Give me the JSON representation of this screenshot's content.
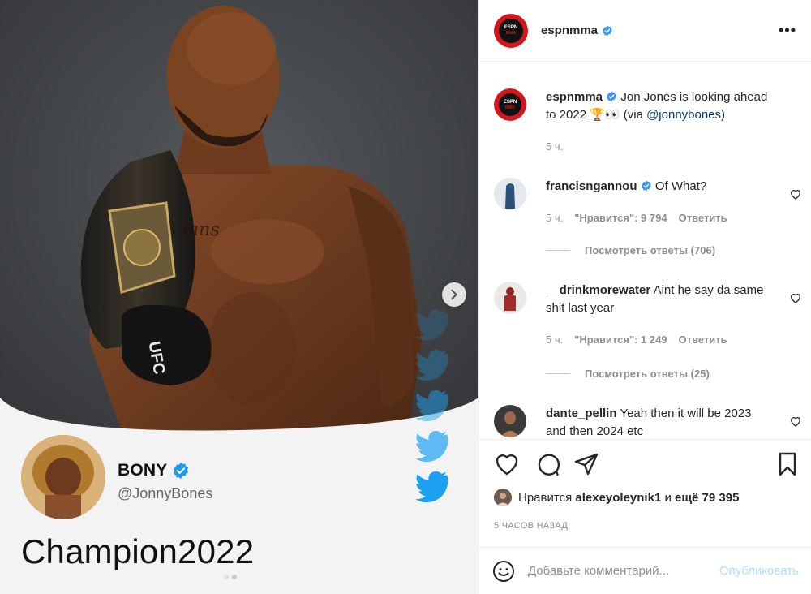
{
  "post": {
    "author": "espnmma",
    "logo_text_top": "ESPN",
    "logo_text_bottom": "MMA",
    "caption_text": "Jon Jones is looking ahead to 2022 🏆👀 (via",
    "caption_mention": "@jonnybones",
    "caption_close": ")",
    "caption_time": "5 ч."
  },
  "media": {
    "tweet_name": "BONY",
    "tweet_handle": "@JonnyBones",
    "tweet_text": "Champion2022",
    "glove_text": "UFC"
  },
  "comments": [
    {
      "user": "francisngannou",
      "verified": true,
      "text": "Of What?",
      "time": "5 ч.",
      "likes": "\"Нравится\": 9 794",
      "reply": "Ответить",
      "view_replies": "Посмотреть ответы (706)"
    },
    {
      "user": "__drinkmorewater",
      "verified": false,
      "text": "Aint he say da same shit last year",
      "time": "5 ч.",
      "likes": "\"Нравится\": 1 249",
      "reply": "Ответить",
      "view_replies": "Посмотреть ответы (25)"
    },
    {
      "user": "dante_pellin",
      "verified": false,
      "text": "Yeah then it will be 2023 and then 2024 etc"
    }
  ],
  "likes_line": {
    "prefix": "Нравится",
    "user": "alexeyoleynik1",
    "middle": "и",
    "rest": "ещё 79 395"
  },
  "time_ago": "5 ЧАСОВ НАЗАД",
  "add_comment": {
    "placeholder": "Добавьте комментарий...",
    "post_label": "Опубликовать"
  },
  "icons": {
    "verified": "verified-badge-icon",
    "more": "more-options-icon",
    "like": "heart-icon",
    "comment": "comment-icon",
    "share": "share-icon",
    "save": "bookmark-icon",
    "emoji": "emoji-icon",
    "next": "chevron-right-icon",
    "twitter": "twitter-bird-icon"
  },
  "colors": {
    "accent": "#0095f6",
    "verified": "#3897f0",
    "link": "#00376b",
    "espn_red": "#d3161d",
    "twitter_blue": "#1da1f2"
  }
}
